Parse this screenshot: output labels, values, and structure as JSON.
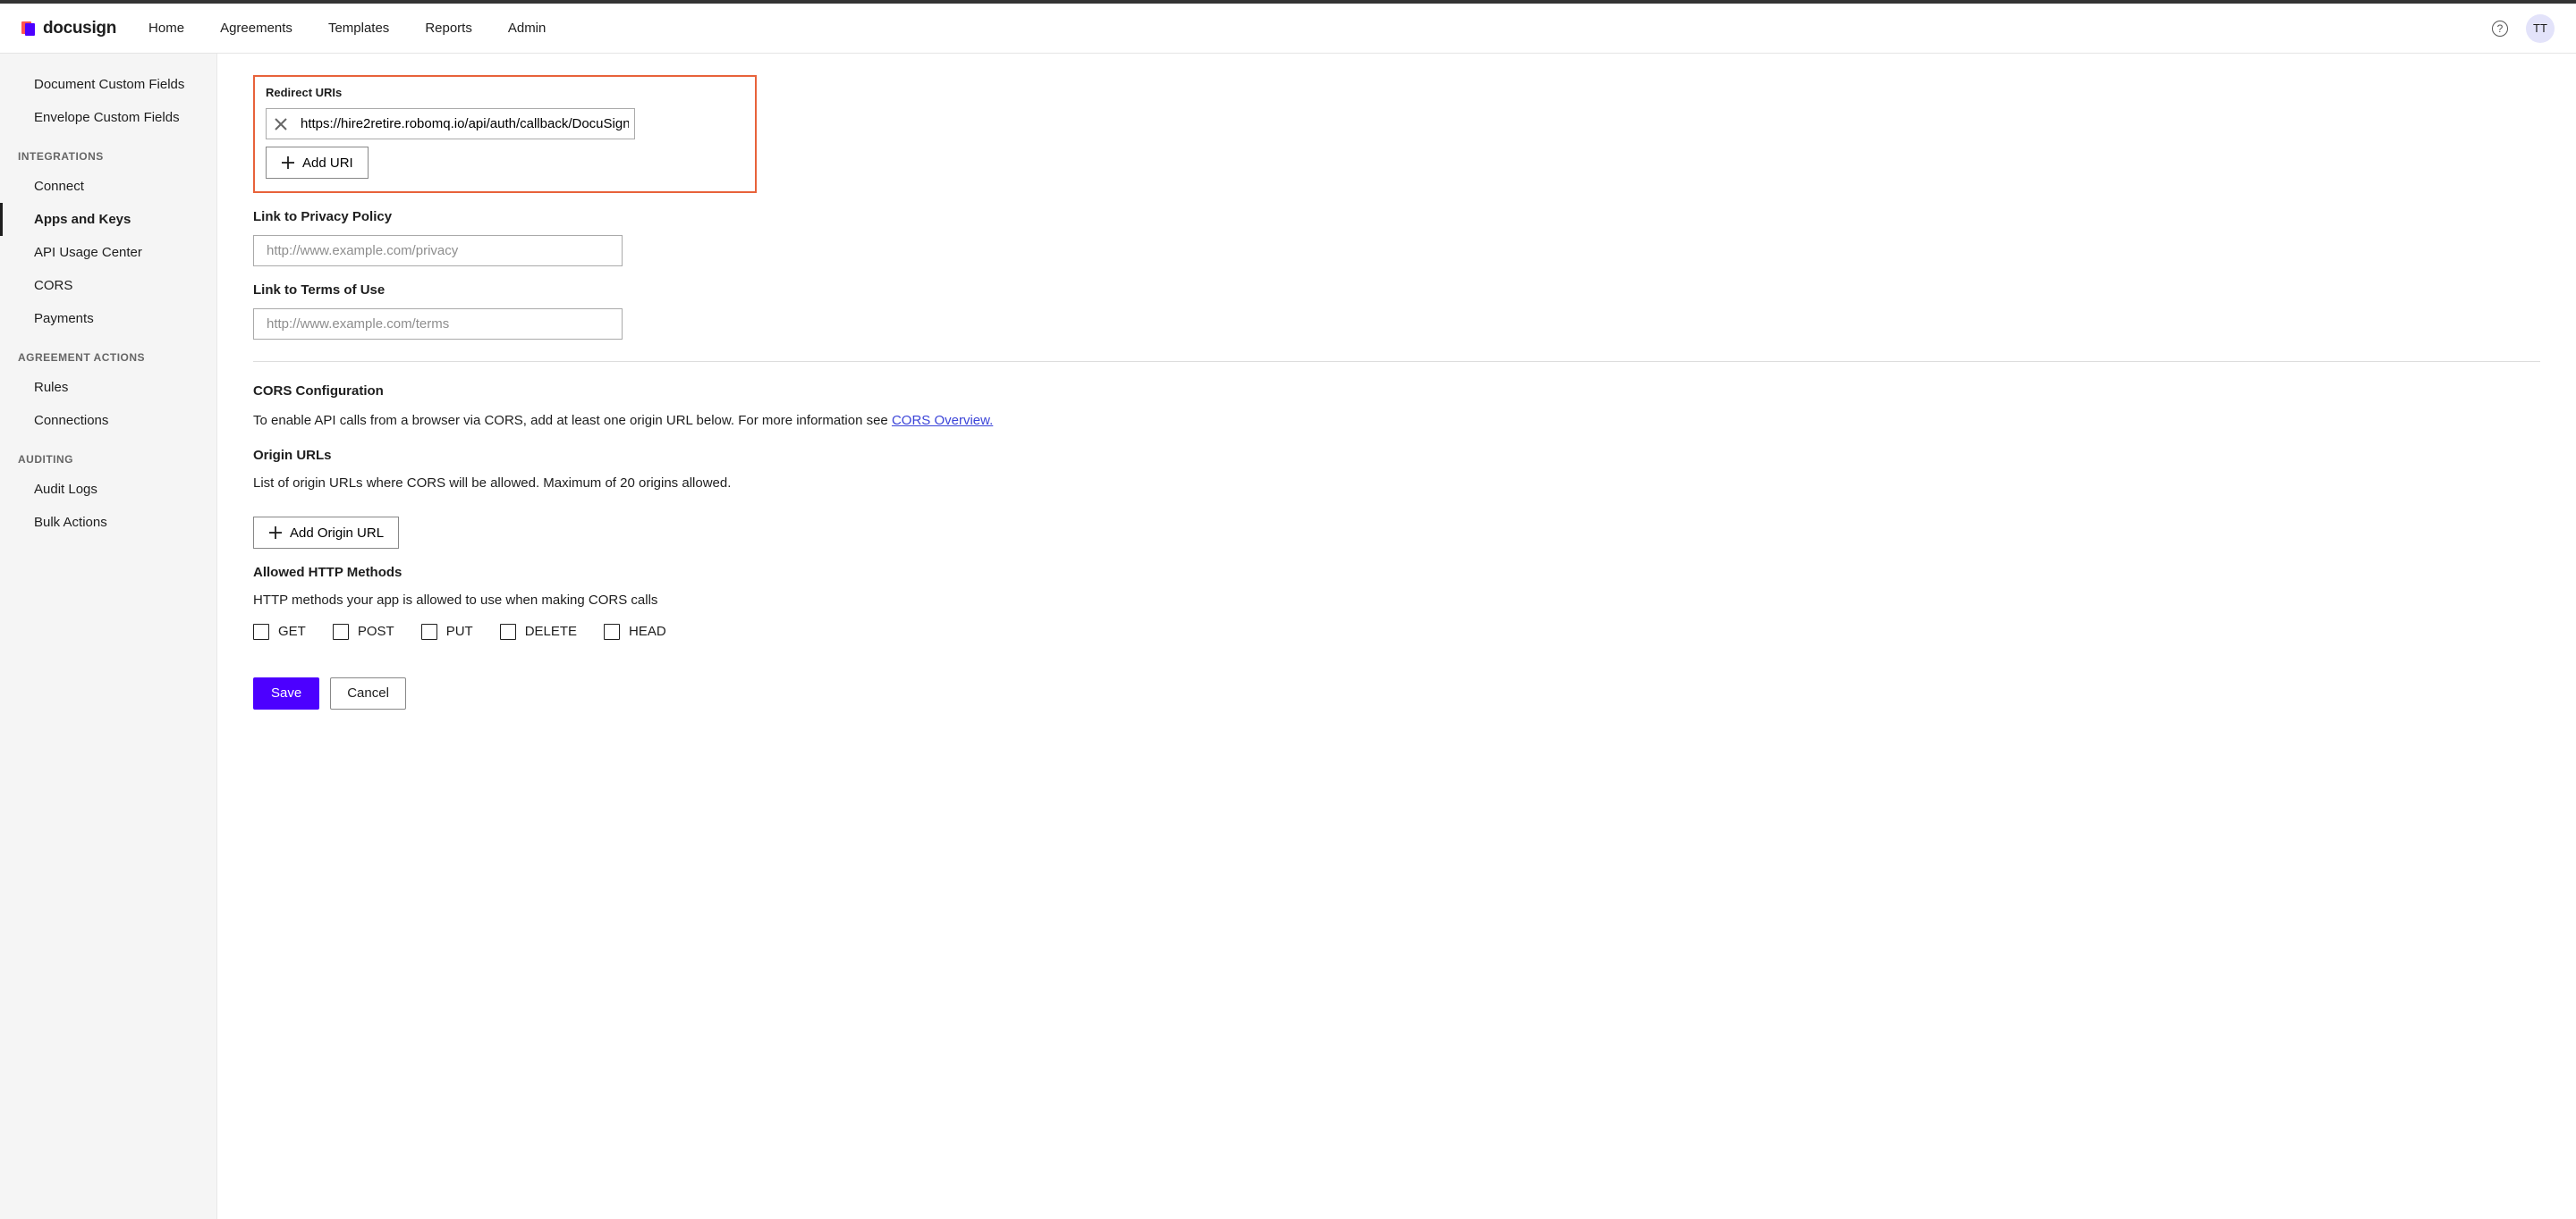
{
  "header": {
    "logo_text": "docusign",
    "nav": [
      "Home",
      "Agreements",
      "Templates",
      "Reports",
      "Admin"
    ],
    "avatar": "TT"
  },
  "sidebar": {
    "top_items": [
      "Document Custom Fields",
      "Envelope Custom Fields"
    ],
    "groups": [
      {
        "heading": "INTEGRATIONS",
        "items": [
          "Connect",
          "Apps and Keys",
          "API Usage Center",
          "CORS",
          "Payments"
        ],
        "active": "Apps and Keys"
      },
      {
        "heading": "AGREEMENT ACTIONS",
        "items": [
          "Rules",
          "Connections"
        ]
      },
      {
        "heading": "AUDITING",
        "items": [
          "Audit Logs",
          "Bulk Actions"
        ]
      }
    ]
  },
  "main": {
    "redirect": {
      "label": "Redirect URIs",
      "uri_value": "https://hire2retire.robomq.io/api/auth/callback/DocuSign",
      "add_label": "Add URI"
    },
    "privacy": {
      "label": "Link to Privacy Policy",
      "placeholder": "http://www.example.com/privacy"
    },
    "terms": {
      "label": "Link to Terms of Use",
      "placeholder": "http://www.example.com/terms"
    },
    "cors": {
      "title": "CORS Configuration",
      "desc_prefix": "To enable API calls from a browser via CORS, add at least one origin URL below. For more information see ",
      "desc_link": "CORS Overview.",
      "origin_title": "Origin URLs",
      "origin_desc": "List of origin URLs where CORS will be allowed. Maximum of 20 origins allowed.",
      "add_origin_label": "Add Origin URL",
      "methods_title": "Allowed HTTP Methods",
      "methods_desc": "HTTP methods your app is allowed to use when making CORS calls",
      "methods": [
        "GET",
        "POST",
        "PUT",
        "DELETE",
        "HEAD"
      ]
    },
    "actions": {
      "save": "Save",
      "cancel": "Cancel"
    }
  }
}
